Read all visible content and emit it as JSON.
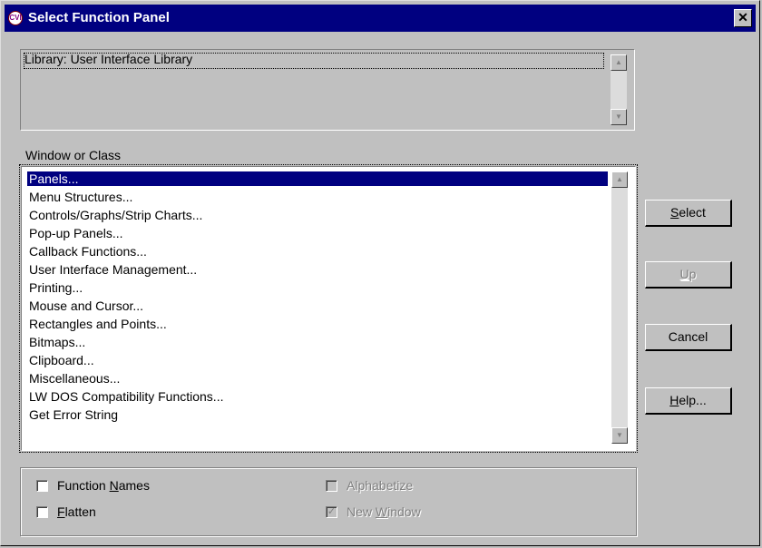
{
  "window": {
    "title": "Select Function Panel",
    "icon_text": "CVI",
    "close_glyph": "✕"
  },
  "library": {
    "text": "Library:  User Interface Library"
  },
  "class_list": {
    "label": "Window or Class",
    "items": [
      {
        "label": "Panels...",
        "selected": true
      },
      {
        "label": "Menu Structures..."
      },
      {
        "label": "Controls/Graphs/Strip Charts..."
      },
      {
        "label": "Pop-up Panels..."
      },
      {
        "label": "Callback Functions..."
      },
      {
        "label": "User Interface Management..."
      },
      {
        "label": "Printing..."
      },
      {
        "label": "Mouse and Cursor..."
      },
      {
        "label": "Rectangles and Points..."
      },
      {
        "label": "Bitmaps..."
      },
      {
        "label": "Clipboard..."
      },
      {
        "label": "Miscellaneous..."
      },
      {
        "label": "LW DOS Compatibility Functions..."
      },
      {
        "label": "Get Error String"
      }
    ]
  },
  "buttons": {
    "select": {
      "pre": "",
      "accel": "S",
      "post": "elect"
    },
    "up": {
      "pre": "",
      "accel": "U",
      "post": "p",
      "disabled": true
    },
    "cancel": {
      "label": "Cancel"
    },
    "help": {
      "pre": "",
      "accel": "H",
      "post": "elp..."
    }
  },
  "options": {
    "function_names": {
      "pre": "Function ",
      "accel": "N",
      "post": "ames",
      "checked": false
    },
    "flatten": {
      "pre": "",
      "accel": "F",
      "post": "latten",
      "checked": false
    },
    "alphabetize": {
      "label": "Alphabetize",
      "checked": false,
      "disabled": true
    },
    "new_window": {
      "pre": "New ",
      "accel": "W",
      "post": "indow",
      "checked": true,
      "disabled": true
    }
  },
  "icons": {
    "scroll_up": "▲",
    "scroll_down": "▼",
    "check": "✓"
  }
}
